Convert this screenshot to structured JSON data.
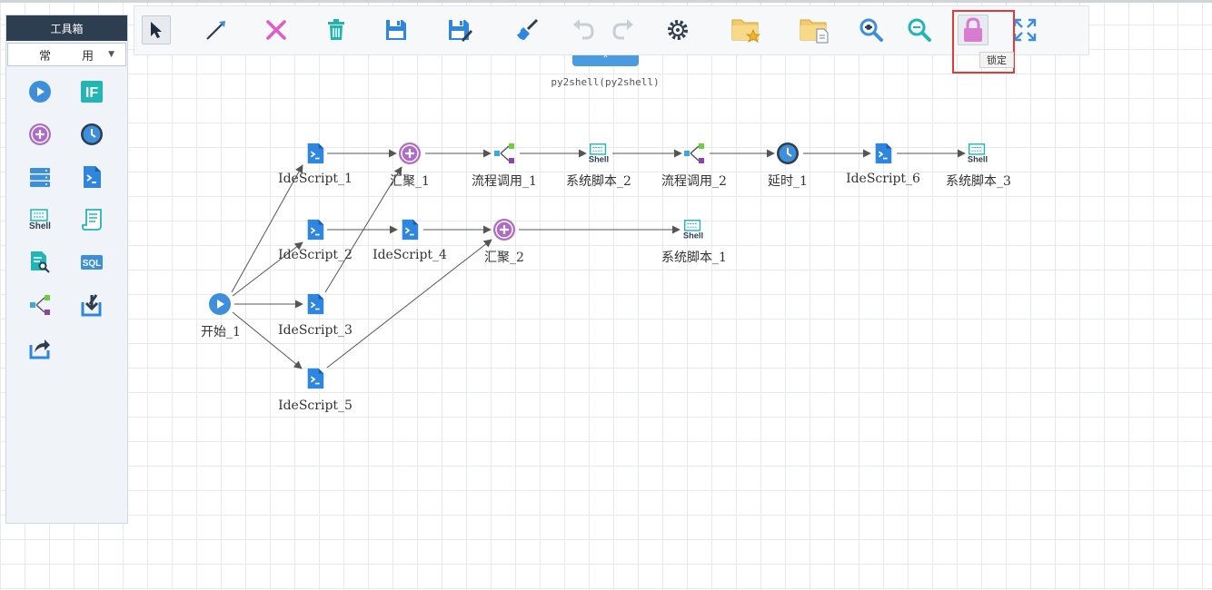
{
  "toolbox": {
    "title": "工具箱",
    "category": "常用",
    "tools": [
      {
        "name": "start",
        "icon": "play-circle-icon"
      },
      {
        "name": "if",
        "icon": "if-icon",
        "text": "IF"
      },
      {
        "name": "converge",
        "icon": "plus-circle-icon"
      },
      {
        "name": "delay",
        "icon": "clock-icon"
      },
      {
        "name": "database",
        "icon": "database-icon"
      },
      {
        "name": "ide-script",
        "icon": "terminal-file-icon"
      },
      {
        "name": "shell",
        "icon": "shell-icon",
        "text": "Shell"
      },
      {
        "name": "script-doc",
        "icon": "scroll-icon"
      },
      {
        "name": "file-search",
        "icon": "file-search-icon"
      },
      {
        "name": "sql",
        "icon": "sql-icon",
        "text": "SQL"
      },
      {
        "name": "flow-call",
        "icon": "flow-call-icon"
      },
      {
        "name": "import",
        "icon": "import-icon"
      },
      {
        "name": "export",
        "icon": "share-icon"
      }
    ]
  },
  "toolbar": {
    "buttons": [
      "select",
      "connect",
      "delete",
      "trash",
      "save",
      "save-as",
      "format",
      "undo",
      "redo",
      "settings",
      "open-folder",
      "folder-file",
      "zoom-in",
      "zoom-out",
      "lock",
      "fullscreen"
    ],
    "collapse_glyph": "⌃",
    "lock_tooltip": "锁定"
  },
  "flow": {
    "title": "py2shell(py2shell)",
    "nodes": [
      {
        "id": "n1",
        "label": "开始_1",
        "type": "start"
      },
      {
        "id": "n2",
        "label": "IdeScript_1",
        "type": "ide"
      },
      {
        "id": "n3",
        "label": "IdeScript_2",
        "type": "ide"
      },
      {
        "id": "n4",
        "label": "IdeScript_3",
        "type": "ide"
      },
      {
        "id": "n5",
        "label": "IdeScript_5",
        "type": "ide"
      },
      {
        "id": "n6",
        "label": "汇聚_1",
        "type": "converge"
      },
      {
        "id": "n7",
        "label": "IdeScript_4",
        "type": "ide"
      },
      {
        "id": "n8",
        "label": "汇聚_2",
        "type": "converge"
      },
      {
        "id": "n9",
        "label": "流程调用_1",
        "type": "flowcall"
      },
      {
        "id": "n10",
        "label": "系统脚本_2",
        "type": "shell"
      },
      {
        "id": "n11",
        "label": "流程调用_2",
        "type": "flowcall"
      },
      {
        "id": "n12",
        "label": "延时_1",
        "type": "delay"
      },
      {
        "id": "n13",
        "label": "IdeScript_6",
        "type": "ide"
      },
      {
        "id": "n14",
        "label": "系统脚本_3",
        "type": "shell"
      },
      {
        "id": "n15",
        "label": "系统脚本_1",
        "type": "shell"
      }
    ]
  },
  "colors": {
    "accent": "#3d8fd9",
    "ide": "#2e86de",
    "converge": "#9b59b6",
    "flowcall_a": "#3ea7e0",
    "flowcall_b": "#6dcf3c",
    "flowcall_c": "#8e44ad",
    "delete": "#e05cc8",
    "trash": "#1fb5ad",
    "lock": "#d97bd0",
    "teal": "#21b5b5"
  }
}
